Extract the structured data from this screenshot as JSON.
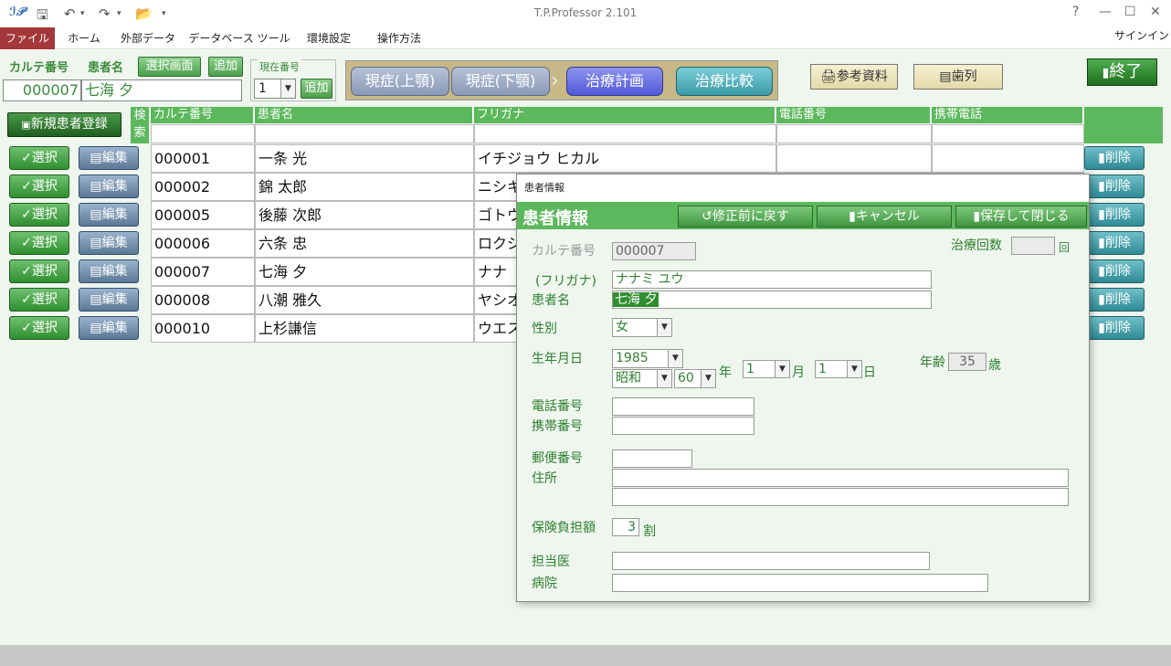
{
  "titlebar": {
    "app_title": "T.P.Professor 2.101",
    "help": "?",
    "minimize": "—",
    "maximize": "☐",
    "close": "✕"
  },
  "ribbon": {
    "tabs": [
      "ファイル",
      "ホーム",
      "外部データ",
      "データベース ツール",
      "環境設定",
      "操作方法"
    ],
    "signin": "サインイン"
  },
  "header": {
    "karte_label": "カルテ番号",
    "patient_label": "患者名",
    "select_screen_btn": "選択画面",
    "add_btn": "追加",
    "current_no_label": "現在番号",
    "current_no_value": "1",
    "current_add_btn": "追加",
    "karte_value": "000007",
    "patient_value": "七海 夕",
    "nav": [
      "現症(上顎)",
      "現症(下顎)",
      "治療計画",
      "治療比較"
    ],
    "reference_btn": "参考資料",
    "dentition_btn": "歯列",
    "exit_btn": "終了"
  },
  "grid": {
    "new_patient_btn": "新規患者登録",
    "search_label": "検索",
    "columns": [
      "カルテ番号",
      "患者名",
      "フリガナ",
      "電話番号",
      "携帯電話"
    ],
    "select_label": "選択",
    "edit_label": "編集",
    "delete_label": "削除",
    "rows": [
      {
        "id": "000001",
        "name": "一条 光",
        "kana": "イチジョウ ヒカル"
      },
      {
        "id": "000002",
        "name": "錦 太郎",
        "kana": "ニシキ"
      },
      {
        "id": "000005",
        "name": "後藤 次郎",
        "kana": "ゴトウ"
      },
      {
        "id": "000006",
        "name": "六条 忠",
        "kana": "ロクジ"
      },
      {
        "id": "000007",
        "name": "七海 夕",
        "kana": "ナナ"
      },
      {
        "id": "000008",
        "name": "八潮 雅久",
        "kana": "ヤシオ"
      },
      {
        "id": "000010",
        "name": "上杉謙信",
        "kana": "ウエス"
      }
    ]
  },
  "dialog": {
    "caption": "患者情報",
    "title": "患者情報",
    "revert_btn": "修正前に戻す",
    "cancel_btn": "キャンセル",
    "save_btn": "保存して閉じる",
    "karte_label": "カルテ番号",
    "karte_value": "000007",
    "visits_label": "治療回数",
    "visits_value": "",
    "visits_unit": "回",
    "kana_label": "(フリガナ)",
    "kana_value": "ナナミ ユウ",
    "name_label": "患者名",
    "name_value": "七海 夕",
    "sex_label": "性別",
    "sex_value": "女",
    "birth_label": "生年月日",
    "birth_year": "1985",
    "era": "昭和",
    "era_year": "60",
    "year_unit": "年",
    "month": "1",
    "month_unit": "月",
    "day": "1",
    "day_unit": "日",
    "age_label": "年齢",
    "age_value": "35",
    "age_unit": "歳",
    "phone_label": "電話番号",
    "mobile_label": "携帯番号",
    "zip_label": "郵便番号",
    "address_label": "住所",
    "insurance_label": "保険負担額",
    "insurance_value": "3",
    "insurance_unit": "割",
    "doctor_label": "担当医",
    "hospital_label": "病院"
  }
}
